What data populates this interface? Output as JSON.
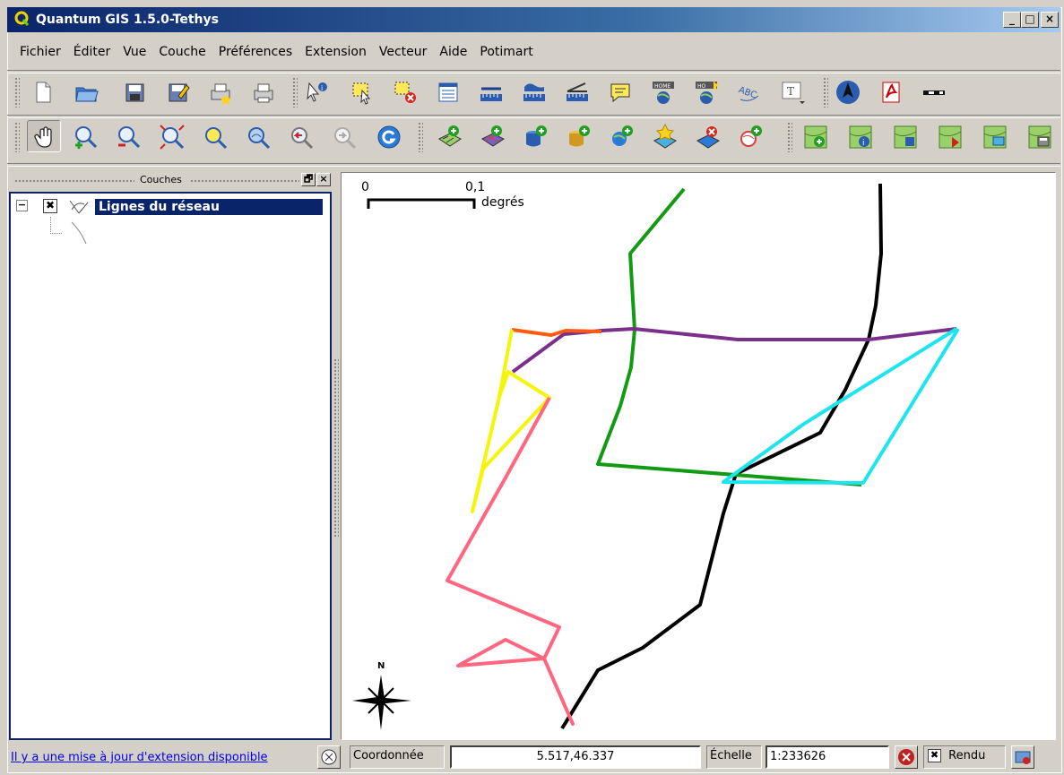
{
  "app": {
    "title": "Quantum GIS 1.5.0-Tethys",
    "colors": {
      "titlebar_start": "#0a246a",
      "titlebar_end": "#a6caf0",
      "selection": "#0a246a"
    }
  },
  "window_controls": {
    "minimize": "_",
    "maximize": "□",
    "close": "×"
  },
  "menu": [
    "Fichier",
    "Éditer",
    "Vue",
    "Couche",
    "Préférences",
    "Extension",
    "Vecteur",
    "Aide",
    "Potimart"
  ],
  "toolbar1": [
    "new-project-icon",
    "open-project-icon",
    "save-project-icon",
    "save-as-icon",
    "print-composer-icon",
    "print-icon",
    "identify-icon",
    "select-features-icon",
    "deselect-icon",
    "attribute-table-icon",
    "measure-line-icon",
    "measure-area-icon",
    "measure-angle-icon",
    "map-tips-icon",
    "new-bookmark-icon",
    "show-bookmarks-icon",
    "label-icon",
    "text-annotation-icon",
    "north-arrow-icon",
    "pdf-export-icon",
    "scale-bar-icon"
  ],
  "toolbar2": [
    "pan-icon",
    "zoom-in-icon",
    "zoom-out-icon",
    "zoom-full-icon",
    "zoom-selection-icon",
    "zoom-layer-icon",
    "zoom-last-icon",
    "zoom-next-icon",
    "refresh-icon",
    "add-vector-layer-icon",
    "add-raster-layer-icon",
    "add-postgis-layer-icon",
    "add-spatialite-layer-icon",
    "add-wms-layer-icon",
    "new-vector-layer-icon",
    "remove-layer-icon",
    "add-wfs-layer-icon",
    "add-all-to-overview-icon",
    "identify-layer-icon",
    "hide-all-layers-icon",
    "show-all-layers-icon",
    "overview-icon",
    "save-layer-icon"
  ],
  "legend": {
    "header": "Couches",
    "layer_name": "Lignes du réseau",
    "float_btn": "🗗",
    "close_btn": "×",
    "expand_symbol": "−",
    "visible_check": "✖"
  },
  "map": {
    "scalebar": {
      "label_start": "0",
      "label_end": "0,1",
      "unit": "degrés"
    },
    "north_label": "N",
    "line_colors": {
      "black": "#000000",
      "green": "#139a13",
      "purple": "#7a2f8b",
      "orange": "#ff5a0f",
      "cyan": "#1de5f0",
      "yellow": "#f5f50a",
      "pink": "#ff6680"
    }
  },
  "status": {
    "plugin_link": "Il y a une mise à jour d'extension disponible",
    "coord_label": "Coordonnée",
    "coord_value": "5.517,46.337",
    "scale_label": "Échelle",
    "scale_value": "1:233626",
    "render_label": "Rendu",
    "render_check": "✖"
  }
}
